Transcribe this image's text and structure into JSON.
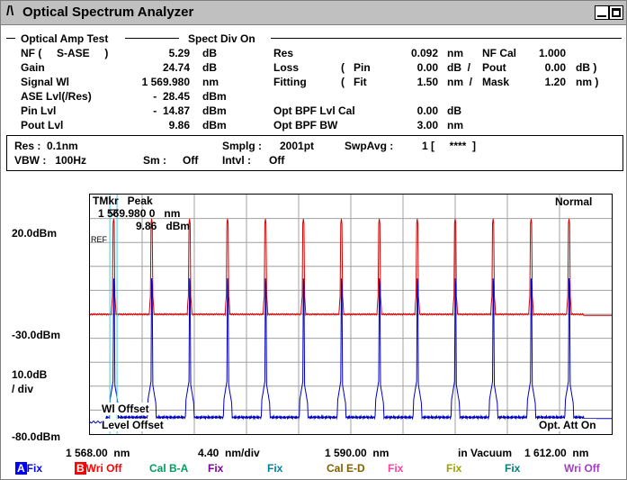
{
  "window": {
    "title": "Optical Spectrum Analyzer",
    "icon": "osa-logo-icon"
  },
  "header": {
    "test_name": "Optical Amp Test",
    "spect_div": "Spect Div On"
  },
  "results_left": [
    {
      "label": "NF (     S-ASE     )",
      "value": "5.29",
      "unit": "dB"
    },
    {
      "label": "Gain",
      "value": "24.74",
      "unit": "dB"
    },
    {
      "label": "Signal Wl",
      "value": "1 569.980",
      "unit": "nm"
    },
    {
      "label": "ASE Lvl(/Res)",
      "value": "-  28.45",
      "unit": "dBm"
    },
    {
      "label": "Pin Lvl",
      "value": "-  14.87",
      "unit": "dBm"
    },
    {
      "label": "Pout Lvl",
      "value": "9.86",
      "unit": "dBm"
    }
  ],
  "results_mid": [
    {
      "label": "Res",
      "pre": "",
      "value": "0.092",
      "unit": "nm"
    },
    {
      "label": "Loss",
      "pre": "(   Pin",
      "value": "0.00",
      "unit": "dB  /"
    },
    {
      "label": "Fitting",
      "pre": "(   Fit",
      "value": "1.50",
      "unit": "nm  /"
    },
    {
      "label": "",
      "pre": "",
      "value": "",
      "unit": ""
    },
    {
      "label": "Opt BPF Lvl Cal",
      "pre": "",
      "value": "0.00",
      "unit": "dB"
    },
    {
      "label": "Opt BPF BW",
      "pre": "",
      "value": "3.00",
      "unit": "nm"
    }
  ],
  "results_right": [
    {
      "label": "NF Cal",
      "value": "1.000",
      "unit": ""
    },
    {
      "label": "Pout",
      "value": "0.00",
      "unit": "dB )"
    },
    {
      "label": "Mask",
      "value": "1.20",
      "unit": "nm )"
    }
  ],
  "settings": {
    "res": "Res :  0.1nm",
    "vbw": "VBW :   100Hz",
    "smplg_label": "Smplg :",
    "smplg_value": "2001pt",
    "swpavg_label": "SwpAvg :",
    "swpavg_value": "1 [     ****  ]",
    "sm_label": "Sm :",
    "sm_value": "Off",
    "intvl_label": "Intvl :",
    "intvl_value": "Off"
  },
  "marker": {
    "title": "TMkr   Peak",
    "wl": "1 569.980 0   nm",
    "level": "9.86   dBm",
    "ref": "REF"
  },
  "trace_mode": "Normal",
  "y_axis": {
    "top": "20.0dBm",
    "mid": "-30.0dBm",
    "scale": "10.0dB",
    "per": "/ div",
    "bottom": "-80.0dBm"
  },
  "bottom_labels": {
    "wl_offset": "Wl Offset",
    "level_offset": "Level Offset",
    "att": "Opt. Att On"
  },
  "x_axis": {
    "start": "1 568.00  nm",
    "span": "4.40  nm/div",
    "center": "1 590.00  nm",
    "medium": "in Vacuum",
    "stop": "1 612.00  nm"
  },
  "traces_legend": [
    {
      "tag": "A",
      "text": "Fix",
      "tag_color": "#0000ff",
      "text_color": "#0000ff"
    },
    {
      "tag": "B",
      "text": "Wri Off",
      "tag_color": "#ff0000",
      "text_color": "#ff0000"
    },
    {
      "tag": "",
      "text": "Cal B-A",
      "text_color": "#00a060"
    },
    {
      "tag": "",
      "text": "Fix",
      "text_color": "#8000a0"
    },
    {
      "tag": "",
      "text": "Fix",
      "text_color": "#0080a0"
    },
    {
      "tag": "",
      "text": "Cal E-D",
      "text_color": "#806000"
    },
    {
      "tag": "",
      "text": "Fix",
      "text_color": "#ff40a0"
    },
    {
      "tag": "",
      "text": "Fix",
      "text_color": "#a0a000"
    },
    {
      "tag": "",
      "text": "Fix",
      "text_color": "#008080"
    },
    {
      "tag": "",
      "text": "Wri Off",
      "text_color": "#a040c0"
    }
  ],
  "chart_data": {
    "type": "line",
    "xlim": [
      1568.0,
      1612.0
    ],
    "ylim": [
      -80.0,
      20.0
    ],
    "grid": true,
    "peaks_nm": [
      1570.0,
      1573.2,
      1576.4,
      1579.6,
      1582.8,
      1586.0,
      1589.2,
      1592.4,
      1595.6,
      1598.8,
      1602.0,
      1605.2,
      1608.4
    ],
    "series": [
      {
        "color": "#d00000",
        "baseline_dbm": -30.0,
        "peak_dbm": 9.86
      },
      {
        "color": "#0000c0",
        "baseline_dbm": -73.0,
        "peak_dbm": -15.0,
        "shoulder_dbm": -58.0
      }
    ],
    "marker_nm": 1569.98
  }
}
